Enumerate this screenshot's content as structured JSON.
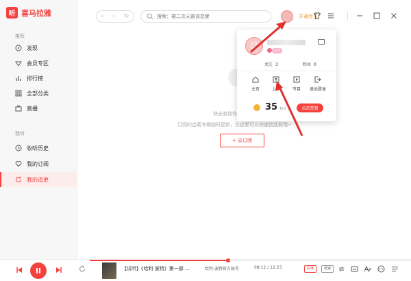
{
  "app": {
    "logo_glyph": "听",
    "name": "喜马拉雅",
    "brand_color": "#f5413d"
  },
  "sidebar": {
    "section_recommend": "推荐",
    "recommend_items": [
      {
        "label": "发现",
        "icon": "compass-icon"
      },
      {
        "label": "会员专区",
        "icon": "vip-icon"
      },
      {
        "label": "排行榜",
        "icon": "ranking-icon"
      },
      {
        "label": "全部分类",
        "icon": "grid-icon"
      },
      {
        "label": "直播",
        "icon": "live-icon"
      }
    ],
    "section_mine": "我听",
    "mine_items": [
      {
        "label": "收听历史",
        "icon": "clock-icon"
      },
      {
        "label": "我的订阅",
        "icon": "heart-icon"
      },
      {
        "label": "我的追更",
        "icon": "refresh-icon",
        "active": true
      }
    ]
  },
  "topbar": {
    "back": "‹",
    "forward": "›",
    "refresh": "↻",
    "search_placeholder": "搜索：被二次元谁谈恋爱",
    "vip_label": "开通会员",
    "icons": [
      "shirt-icon",
      "menu-icon",
      "minimize-icon",
      "maximize-icon",
      "close-icon"
    ]
  },
  "main": {
    "empty_line1": "快去查找你喜欢的节目吧~",
    "empty_line2": "订阅的连载专辑随时更新，在这里可以快速追连载哦~",
    "subscribe_button": "+ 去订阅"
  },
  "profile_popup": {
    "follow_label": "关注",
    "follow_count": "3",
    "fans_label": "粉丝",
    "fans_count": "0",
    "level_badge": "Lv1",
    "actions": [
      {
        "label": "主页",
        "icon": "home-icon"
      },
      {
        "label": "上传",
        "icon": "upload-icon"
      },
      {
        "label": "节目",
        "icon": "play-box-icon"
      },
      {
        "label": "退出登录",
        "icon": "logout-icon"
      }
    ],
    "coins": "35",
    "coin_unit": "积分",
    "checkin_button": "点击签到"
  },
  "player": {
    "track_title": "【试听】《哈利·波特》第一部 ...",
    "artist": "哈利·波特官方账号",
    "time": "08:12 / 12:23",
    "progress": 0.43,
    "quality_tag": "标准",
    "speed_tag": "倍速",
    "icons": [
      "loop-icon",
      "subtitle-icon",
      "font-size-icon",
      "more-icon",
      "playlist-icon"
    ]
  }
}
